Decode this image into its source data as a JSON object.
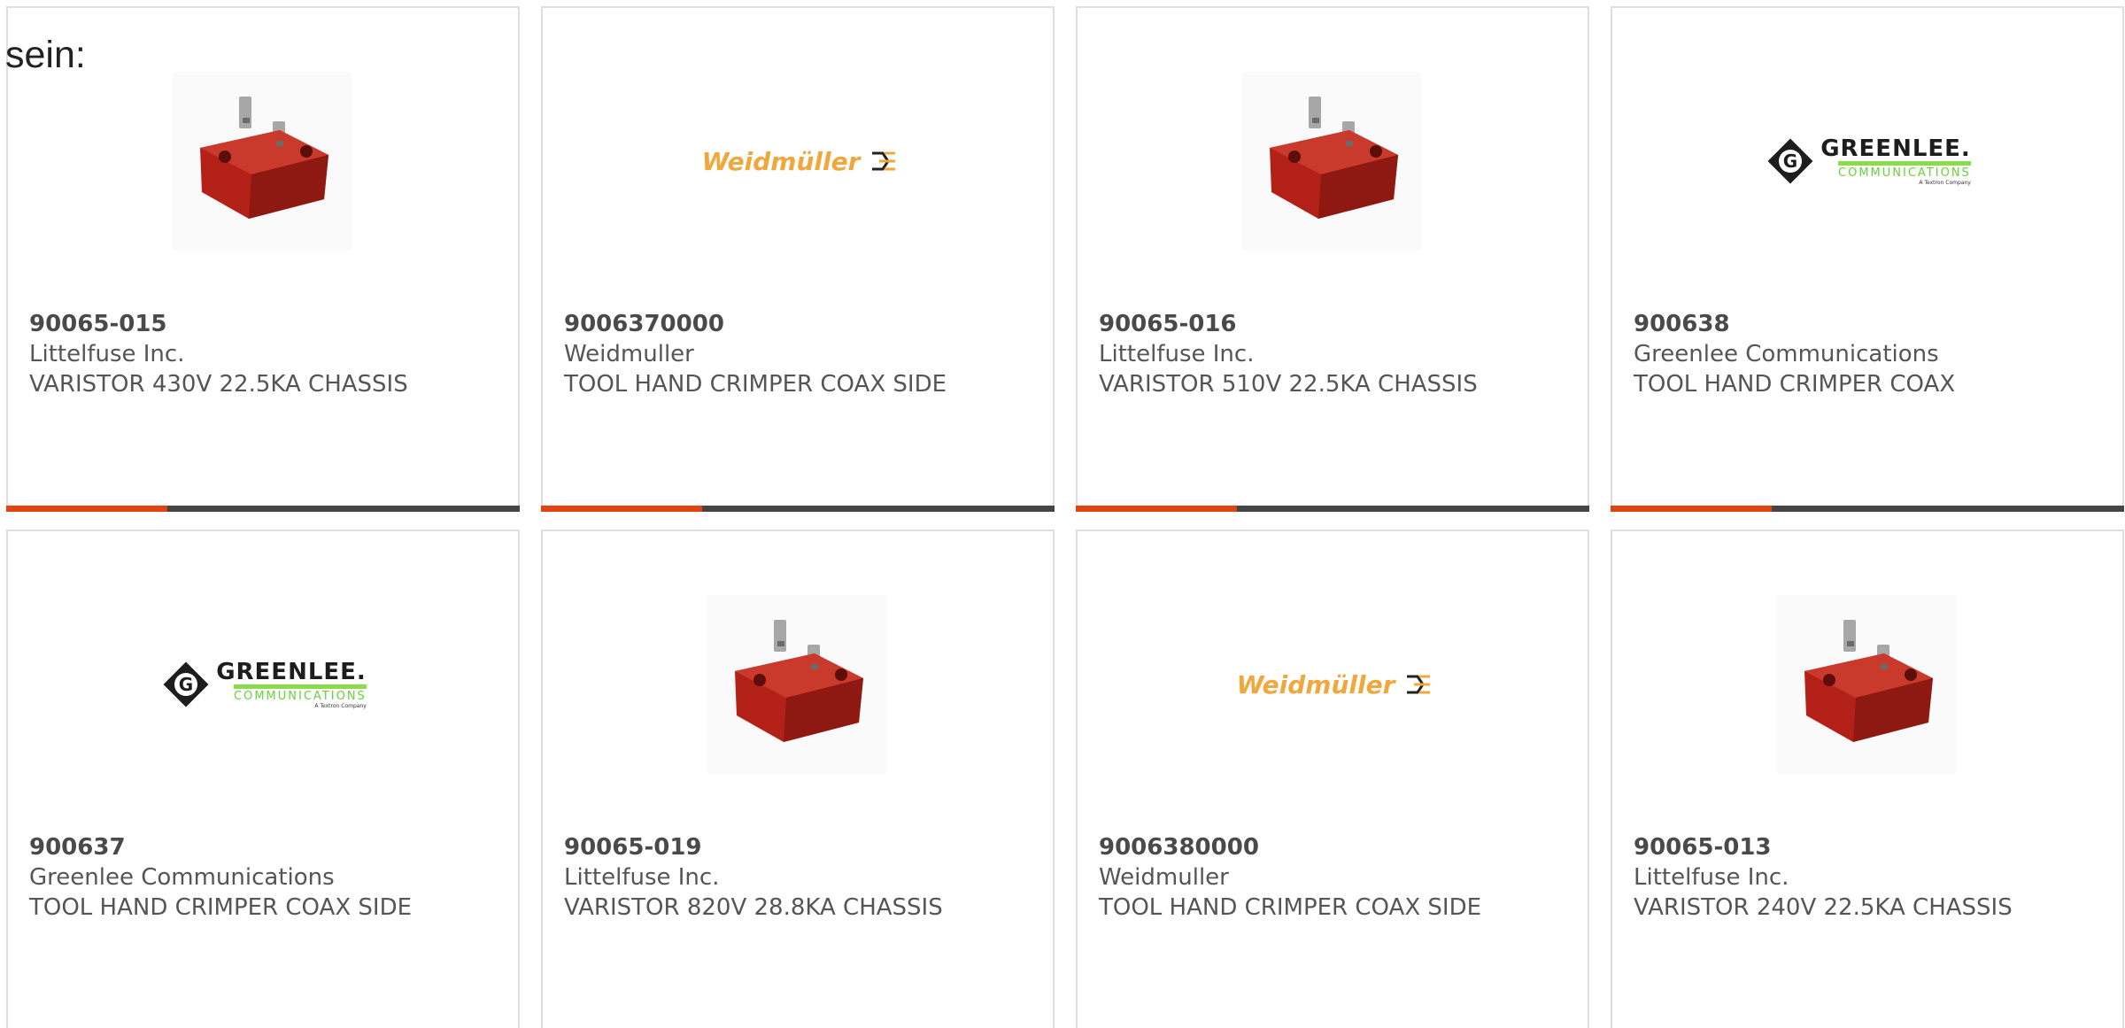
{
  "intro_text": "sein:",
  "colors": {
    "accent_bar": "#e2440f",
    "dark_bar": "#444444",
    "weidmuller_orange": "#f0a73c",
    "greenlee_green": "#8bdc4a",
    "varistor_red": "#b32018"
  },
  "logos": {
    "weidmuller": "Weidmüller",
    "greenlee_main": "GREENLEE.",
    "greenlee_sub": "COMMUNICATIONS",
    "greenlee_tag": "A Textron Company"
  },
  "products": [
    {
      "part": "90065-015",
      "maker": "Littelfuse Inc.",
      "desc": "VARISTOR 430V 22.5KA CHASSIS",
      "image": "varistor-image"
    },
    {
      "part": "9006370000",
      "maker": "Weidmuller",
      "desc": "TOOL HAND CRIMPER COAX SIDE",
      "image": "weidmuller-logo"
    },
    {
      "part": "90065-016",
      "maker": "Littelfuse Inc.",
      "desc": "VARISTOR 510V 22.5KA CHASSIS",
      "image": "varistor-image"
    },
    {
      "part": "900638",
      "maker": "Greenlee Communications",
      "desc": "TOOL HAND CRIMPER COAX",
      "image": "greenlee-logo"
    },
    {
      "part": "900637",
      "maker": "Greenlee Communications",
      "desc": "TOOL HAND CRIMPER COAX SIDE",
      "image": "greenlee-logo"
    },
    {
      "part": "90065-019",
      "maker": "Littelfuse Inc.",
      "desc": "VARISTOR 820V 28.8KA CHASSIS",
      "image": "varistor-image"
    },
    {
      "part": "9006380000",
      "maker": "Weidmuller",
      "desc": "TOOL HAND CRIMPER COAX SIDE",
      "image": "weidmuller-logo"
    },
    {
      "part": "90065-013",
      "maker": "Littelfuse Inc.",
      "desc": "VARISTOR 240V 22.5KA CHASSIS",
      "image": "varistor-image"
    }
  ]
}
